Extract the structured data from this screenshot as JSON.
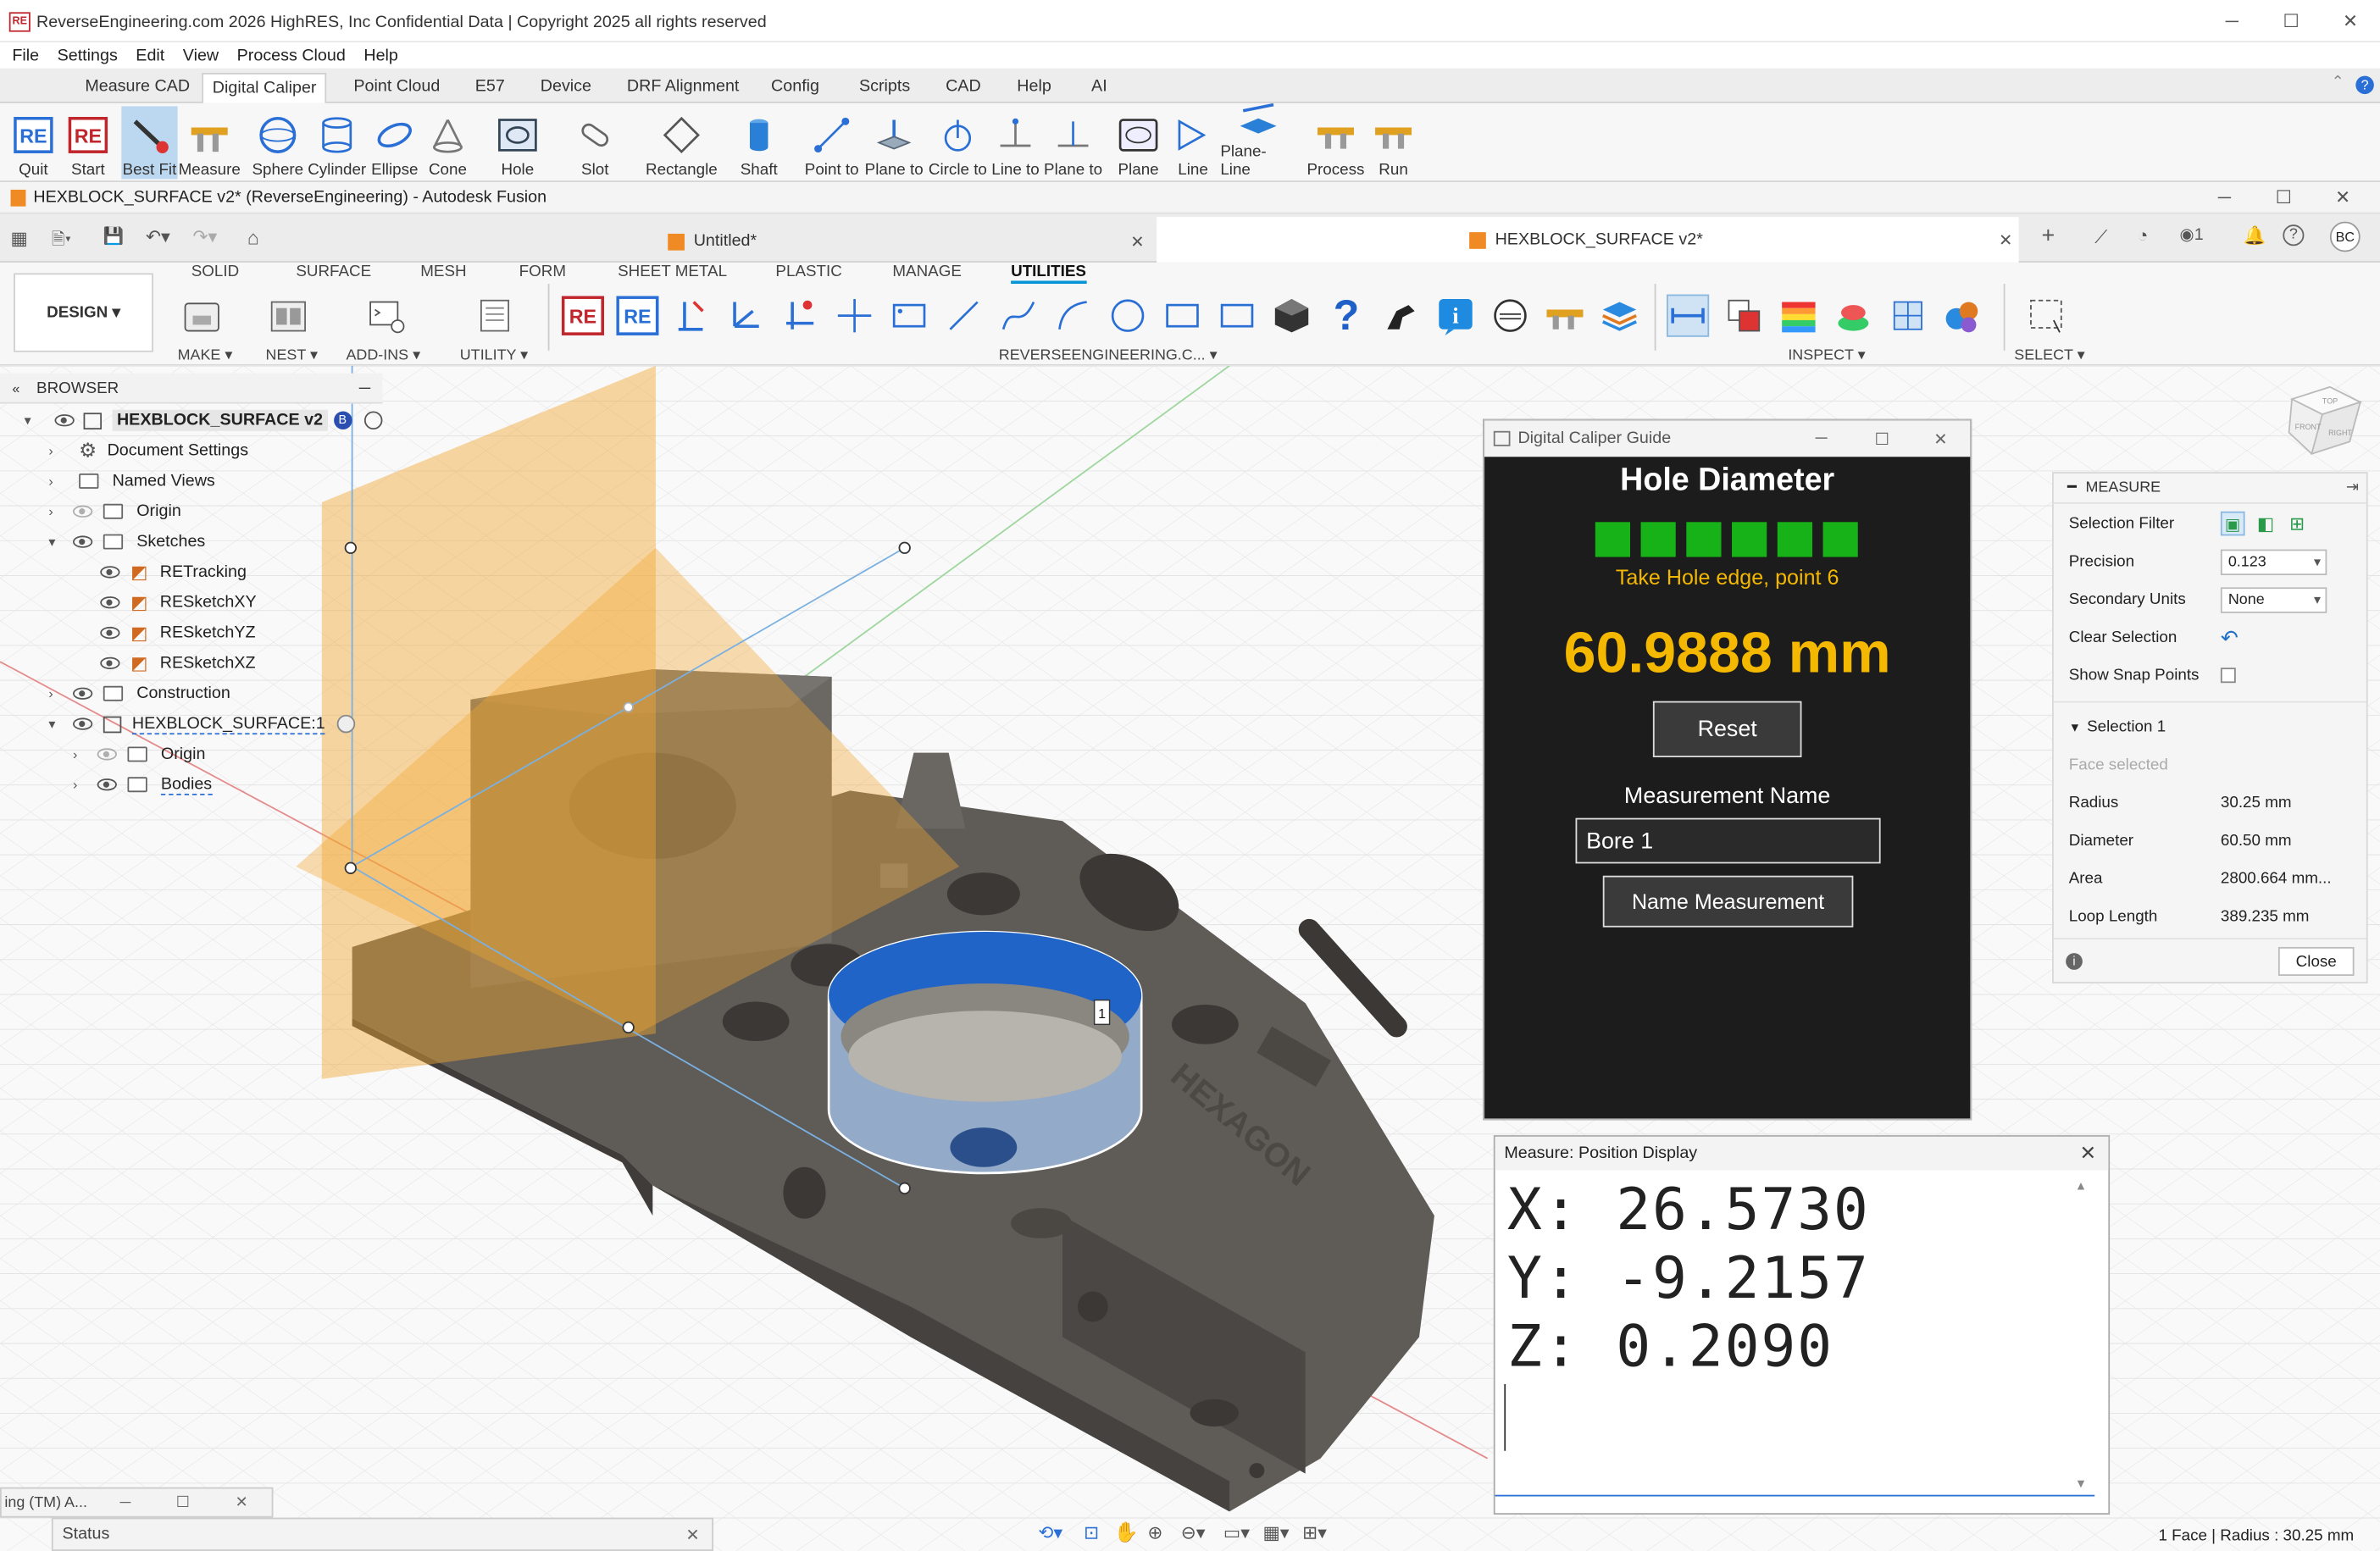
{
  "app": {
    "title": "ReverseEngineering.com 2026    HighRES, Inc Confidential Data | Copyright 2025 all rights reserved",
    "logo": "RE",
    "menu": [
      "File",
      "Settings",
      "Edit",
      "View",
      "Process Cloud",
      "Help"
    ],
    "ribbon_tabs": [
      "Measure CAD",
      "Digital Caliper",
      "Point Cloud",
      "E57",
      "Device",
      "DRF Alignment",
      "Config",
      "Scripts",
      "CAD",
      "Help",
      "AI"
    ],
    "active_ribbon_tab": "Digital Caliper",
    "ribbon_buttons": [
      "Quit",
      "Start",
      "Best Fit",
      "Measure",
      "Sphere",
      "Cylinder",
      "Ellipse",
      "Cone",
      "Hole",
      "Slot",
      "Rectangle",
      "Shaft",
      "Point to",
      "Plane to",
      "Circle to",
      "Line to",
      "Plane to",
      "Plane",
      "Line",
      "Plane-Line",
      "Process",
      "Run"
    ]
  },
  "fusion": {
    "window_title": "HEXBLOCK_SURFACE v2* (ReverseEngineering) - Autodesk Fusion",
    "doc_tabs": [
      "Untitled*",
      "HEXBLOCK_SURFACE v2*"
    ],
    "user_initials": "BC",
    "notif_count": "1",
    "workspace": "DESIGN",
    "toolbar_tabs": [
      "SOLID",
      "SURFACE",
      "MESH",
      "FORM",
      "SHEET METAL",
      "PLASTIC",
      "MANAGE",
      "UTILITIES"
    ],
    "active_toolbar_tab": "UTILITIES",
    "groups": [
      "MAKE",
      "NEST",
      "ADD-INS",
      "UTILITY",
      "REVERSEENGINEERING.C...",
      "INSPECT",
      "SELECT"
    ],
    "browser": {
      "header": "BROWSER",
      "root": "HEXBLOCK_SURFACE v2",
      "items": [
        "Document Settings",
        "Named Views",
        "Origin",
        "Sketches",
        "RETracking",
        "RESketchXY",
        "RESketchYZ",
        "RESketchXZ",
        "Construction",
        "HEXBLOCK_SURFACE:1",
        "Origin",
        "Bodies"
      ]
    },
    "viewcube_faces": [
      "TOP",
      "RIGHT",
      "FRONT"
    ],
    "tag_label": "1",
    "status_bar": "1 Face | Radius : 30.25 mm"
  },
  "guide": {
    "window_title": "Digital Caliper Guide",
    "heading": "Hole Diameter",
    "progress_count": 6,
    "instruction": "Take Hole edge, point 6",
    "value": "60.9888 mm",
    "reset_label": "Reset",
    "name_label": "Measurement Name",
    "name_value": "Bore 1",
    "name_button": "Name Measurement",
    "accent_color": "#f5b800",
    "progress_color": "#17b217"
  },
  "measure": {
    "header": "MEASURE",
    "selection_filter_label": "Selection Filter",
    "precision_label": "Precision",
    "precision_value": "0.123",
    "secondary_units_label": "Secondary Units",
    "secondary_units_value": "None",
    "clear_selection_label": "Clear Selection",
    "show_snap_label": "Show Snap Points",
    "selection_header": "Selection 1",
    "face_selected": "Face selected",
    "rows": [
      {
        "label": "Radius",
        "value": "30.25 mm"
      },
      {
        "label": "Diameter",
        "value": "60.50 mm"
      },
      {
        "label": "Area",
        "value": "2800.664 mm..."
      },
      {
        "label": "Loop Length",
        "value": "389.235 mm"
      }
    ],
    "close_label": "Close"
  },
  "position": {
    "window_title": "Measure: Position Display",
    "x": "X: 26.5730",
    "y": "Y: -9.2157",
    "z": "Z: 0.2090"
  },
  "mini_window": {
    "title": "ing (TM) A..."
  },
  "status_window": {
    "title": "Status"
  }
}
